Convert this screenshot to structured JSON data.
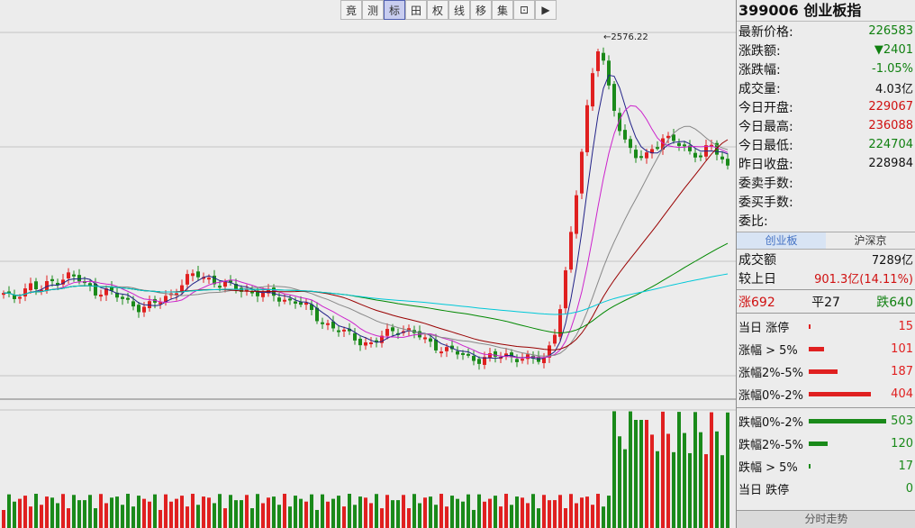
{
  "toolbar": [
    "竟",
    "测",
    "标",
    "田",
    "权",
    "线",
    "移",
    "集",
    "⊡",
    "▶"
  ],
  "toolbar_active": 2,
  "header": {
    "code": "399006",
    "name": "创业板指"
  },
  "quote": [
    {
      "label": "最新价格:",
      "value": "226583",
      "color": "green"
    },
    {
      "label": "涨跌额:",
      "value": "▼2401",
      "color": "green"
    },
    {
      "label": "涨跌幅:",
      "value": "-1.05%",
      "color": "green"
    },
    {
      "label": "成交量:",
      "value": "4.03亿",
      "color": "black"
    },
    {
      "label": "今日开盘:",
      "value": "229067",
      "color": "red"
    },
    {
      "label": "今日最高:",
      "value": "236088",
      "color": "red"
    },
    {
      "label": "今日最低:",
      "value": "224704",
      "color": "green"
    },
    {
      "label": "昨日收盘:",
      "value": "228984",
      "color": "black"
    },
    {
      "label": "委卖手数:",
      "value": "",
      "color": "black"
    },
    {
      "label": "委买手数:",
      "value": "",
      "color": "black"
    },
    {
      "label": "委比:",
      "value": "",
      "color": "black"
    }
  ],
  "tabs": [
    "创业板",
    "沪深京"
  ],
  "turnover": {
    "label": "成交额",
    "value": "7289亿"
  },
  "compare": {
    "label": "较上日",
    "value": "901.3亿(14.11%)"
  },
  "breadth": {
    "up": "涨692",
    "flat": "平27",
    "down": "跌640"
  },
  "dist": [
    {
      "label": "当日 涨停",
      "value": "15",
      "color": "#e02020",
      "bar": 0.02
    },
    {
      "label": "涨幅 > 5%",
      "value": "101",
      "color": "#e02020",
      "bar": 0.2
    },
    {
      "label": "涨幅2%-5%",
      "value": "187",
      "color": "#e02020",
      "bar": 0.37
    },
    {
      "label": "涨幅0%-2%",
      "value": "404",
      "color": "#e02020",
      "bar": 0.8
    },
    {
      "label": "跌幅0%-2%",
      "value": "503",
      "color": "#1a8a1a",
      "bar": 1.0
    },
    {
      "label": "跌幅2%-5%",
      "value": "120",
      "color": "#1a8a1a",
      "bar": 0.24
    },
    {
      "label": "跌幅 > 5%",
      "value": "17",
      "color": "#1a8a1a",
      "bar": 0.02
    },
    {
      "label": "当日 跌停",
      "value": "0",
      "color": "#1a8a1a",
      "bar": 0
    }
  ],
  "bottom_tab": "分时走势",
  "chart_data": {
    "type": "candlestick",
    "annotation": "2576.22",
    "closes": [
      1960,
      1950,
      1975,
      1985,
      1970,
      1990,
      2000,
      2010,
      2000,
      1985,
      1970,
      1975,
      1960,
      1950,
      1940,
      1930,
      1935,
      1945,
      1960,
      1980,
      2000,
      2010,
      2005,
      1995,
      1985,
      1980,
      1975,
      1970,
      1965,
      1960,
      1955,
      1950,
      1945,
      1930,
      1910,
      1895,
      1880,
      1870,
      1860,
      1850,
      1840,
      1855,
      1870,
      1880,
      1875,
      1865,
      1850,
      1840,
      1830,
      1822,
      1815,
      1810,
      1805,
      1808,
      1812,
      1815,
      1810,
      1805,
      1800,
      1810,
      1860,
      1960,
      2120,
      2300,
      2480,
      2576,
      2460,
      2380,
      2330,
      2300,
      2290,
      2320,
      2350,
      2340,
      2320,
      2300,
      2310,
      2330,
      2300,
      2266
    ],
    "ma_colors": [
      "#222288",
      "#cc22cc",
      "#888888",
      "#990000",
      "#008800",
      "#00c8d8"
    ]
  }
}
